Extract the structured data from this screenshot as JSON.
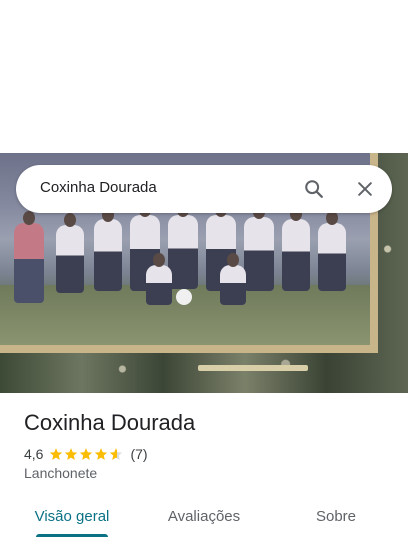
{
  "search": {
    "query": "Coxinha Dourada",
    "search_icon": "search-icon",
    "close_icon": "close-icon"
  },
  "place": {
    "name": "Coxinha Dourada",
    "rating": "4,6",
    "rating_value": 4.6,
    "review_count": "(7)",
    "category": "Lanchonete",
    "star_color": "#fbbc04"
  },
  "tabs": [
    {
      "label": "Visão geral",
      "active": true
    },
    {
      "label": "Avaliações",
      "active": false
    },
    {
      "label": "Sobre",
      "active": false
    }
  ],
  "colors": {
    "accent": "#0b7285"
  }
}
